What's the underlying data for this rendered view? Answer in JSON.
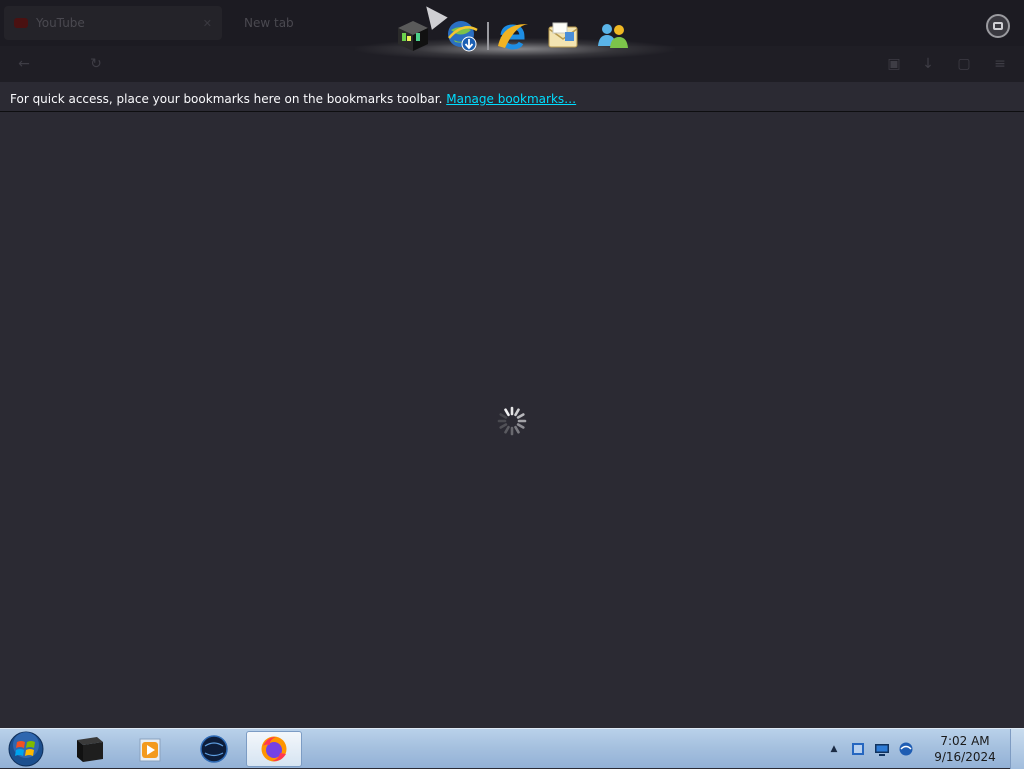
{
  "browser": {
    "tabs": [
      {
        "title": "YouTube",
        "active": true
      },
      {
        "title": "New tab",
        "active": false
      }
    ],
    "bookmarks_bar": {
      "message": "For quick access, place your bookmarks here on the bookmarks toolbar.",
      "link_text": "Manage bookmarks…"
    },
    "page_state": "loading"
  },
  "dock": {
    "icons": [
      "windows-explorer-cube-icon",
      "globe-download-icon",
      "internet-explorer-icon",
      "mail-envelope-icon",
      "messenger-buddies-icon"
    ]
  },
  "taskbar": {
    "pinned": [
      {
        "name": "terminal-icon",
        "active": false
      },
      {
        "name": "media-player-icon",
        "active": false
      },
      {
        "name": "network-globe-icon",
        "active": false
      },
      {
        "name": "firefox-icon",
        "active": true
      }
    ],
    "tray": {
      "clock_time": "7:02 AM",
      "clock_date": "9/16/2024"
    }
  },
  "colors": {
    "page_background": "#2b2a33",
    "link": "#00ddff",
    "taskbar": "#a6c1df"
  }
}
